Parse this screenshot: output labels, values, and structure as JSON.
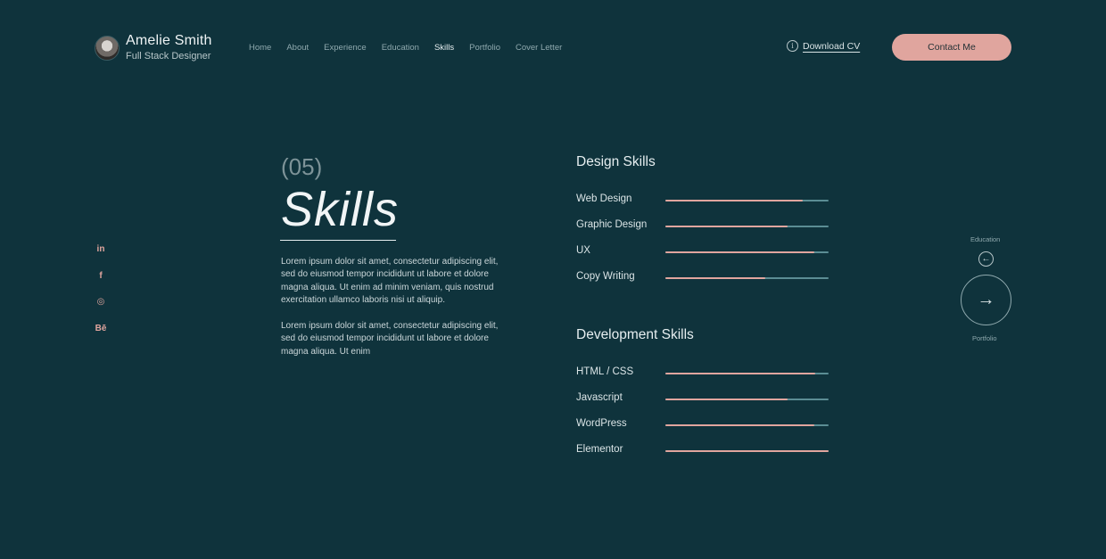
{
  "header": {
    "name": "Amelie Smith",
    "role": "Full Stack Designer",
    "nav": [
      "Home",
      "About",
      "Experience",
      "Education",
      "Skills",
      "Portfolio",
      "Cover Letter"
    ],
    "active_nav": "Skills",
    "download_label": "Download CV",
    "info_glyph": "i",
    "contact_label": "Contact Me"
  },
  "social": [
    {
      "icon": "linkedin-icon",
      "glyph": "in"
    },
    {
      "icon": "facebook-icon",
      "glyph": "f"
    },
    {
      "icon": "instagram-icon",
      "glyph": "◎"
    },
    {
      "icon": "behance-icon",
      "glyph": "Bē"
    }
  ],
  "section": {
    "number": "(05)",
    "title": "Skills",
    "paragraph1": "Lorem ipsum dolor sit amet, consectetur adipiscing elit, sed do eiusmod tempor incididunt ut labore et dolore magna aliqua. Ut enim ad minim veniam, quis nostrud exercitation ullamco laboris nisi ut aliquip.",
    "paragraph2": "Lorem ipsum dolor sit amet, consectetur adipiscing elit, sed do eiusmod tempor incididunt ut labore et dolore magna aliqua. Ut enim"
  },
  "design_skills": {
    "title": "Design Skills",
    "items": [
      {
        "label": "Web Design",
        "level": 0.84
      },
      {
        "label": "Graphic Design",
        "level": 0.75
      },
      {
        "label": "UX",
        "level": 0.91
      },
      {
        "label": "Copy Writing",
        "level": 0.61
      }
    ]
  },
  "development_skills": {
    "title": "Development Skills",
    "items": [
      {
        "label": "HTML / CSS",
        "level": 0.92
      },
      {
        "label": "Javascript",
        "level": 0.75
      },
      {
        "label": "WordPress",
        "level": 0.91
      },
      {
        "label": "Elementor",
        "level": 1.0
      }
    ]
  },
  "pager": {
    "prev_label": "Education",
    "next_label": "Portfolio",
    "prev_glyph": "←",
    "next_glyph": "→"
  },
  "colors": {
    "background": "#0f333c",
    "accent": "#e0a59e",
    "track": "#5b8d94"
  }
}
